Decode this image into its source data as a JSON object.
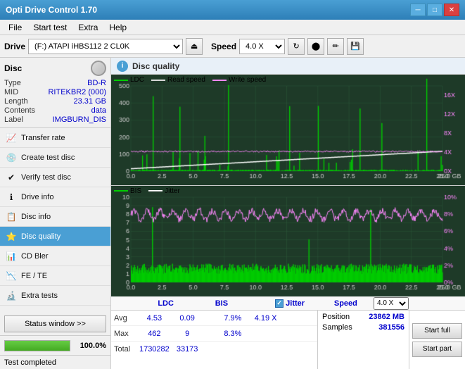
{
  "titlebar": {
    "title": "Opti Drive Control 1.70",
    "minimize": "─",
    "maximize": "□",
    "close": "✕"
  },
  "menubar": {
    "items": [
      "File",
      "Start test",
      "Extra",
      "Help"
    ]
  },
  "toolbar": {
    "drive_label": "Drive",
    "drive_value": "(F:)  ATAPI iHBS112  2 CL0K",
    "eject_symbol": "⏏",
    "speed_label": "Speed",
    "speed_value": "4.0 X",
    "refresh_symbol": "↻",
    "disc_symbol": "💿",
    "write_symbol": "✏",
    "save_symbol": "💾"
  },
  "disc_info": {
    "panel_label": "Disc",
    "type_key": "Type",
    "type_val": "BD-R",
    "mid_key": "MID",
    "mid_val": "RITEKBR2 (000)",
    "length_key": "Length",
    "length_val": "23.31 GB",
    "contents_key": "Contents",
    "contents_val": "data",
    "label_key": "Label",
    "label_val": "IMGBURN_DIS"
  },
  "nav_items": [
    {
      "id": "transfer-rate",
      "label": "Transfer rate",
      "icon": "📈"
    },
    {
      "id": "create-test-disc",
      "label": "Create test disc",
      "icon": "💿"
    },
    {
      "id": "verify-test-disc",
      "label": "Verify test disc",
      "icon": "✔"
    },
    {
      "id": "drive-info",
      "label": "Drive info",
      "icon": "ℹ"
    },
    {
      "id": "disc-info",
      "label": "Disc info",
      "icon": "📋"
    },
    {
      "id": "disc-quality",
      "label": "Disc quality",
      "icon": "⭐",
      "active": true
    },
    {
      "id": "cd-bler",
      "label": "CD Bler",
      "icon": "📊"
    },
    {
      "id": "fe-te",
      "label": "FE / TE",
      "icon": "📉"
    },
    {
      "id": "extra-tests",
      "label": "Extra tests",
      "icon": "🔬"
    }
  ],
  "status_window_btn": "Status window >>",
  "progress": {
    "text": "Test completed",
    "pct": 100.0,
    "pct_display": "100.0%"
  },
  "disc_quality": {
    "title": "Disc quality",
    "legend": {
      "ldc": "LDC",
      "read_speed": "Read speed",
      "write_speed": "Write speed",
      "bis": "BIS",
      "jitter": "Jitter"
    }
  },
  "stats": {
    "columns": [
      "",
      "LDC",
      "BIS",
      "",
      "Jitter",
      "Speed",
      ""
    ],
    "avg_label": "Avg",
    "avg_ldc": "4.53",
    "avg_bis": "0.09",
    "avg_jitter": "7.9%",
    "avg_speed": "4.19 X",
    "max_label": "Max",
    "max_ldc": "462",
    "max_bis": "9",
    "max_jitter": "8.3%",
    "total_label": "Total",
    "total_ldc": "1730282",
    "total_bis": "33173",
    "position_key": "Position",
    "position_val": "23862 MB",
    "samples_key": "Samples",
    "samples_val": "381556",
    "speed_dropdown": "4.0 X",
    "btn_start_full": "Start full",
    "btn_start_part": "Start part"
  },
  "statusbar": {
    "text": "Test completed"
  },
  "colors": {
    "ldc": "#00cc00",
    "read_speed": "#ffffff",
    "write_speed": "#ff00ff",
    "bis": "#ff00ff",
    "jitter": "#ffffff",
    "chart_bg": "#1a3a2a",
    "grid": "#2a5a3a",
    "accent_blue": "#4a9fd4"
  }
}
